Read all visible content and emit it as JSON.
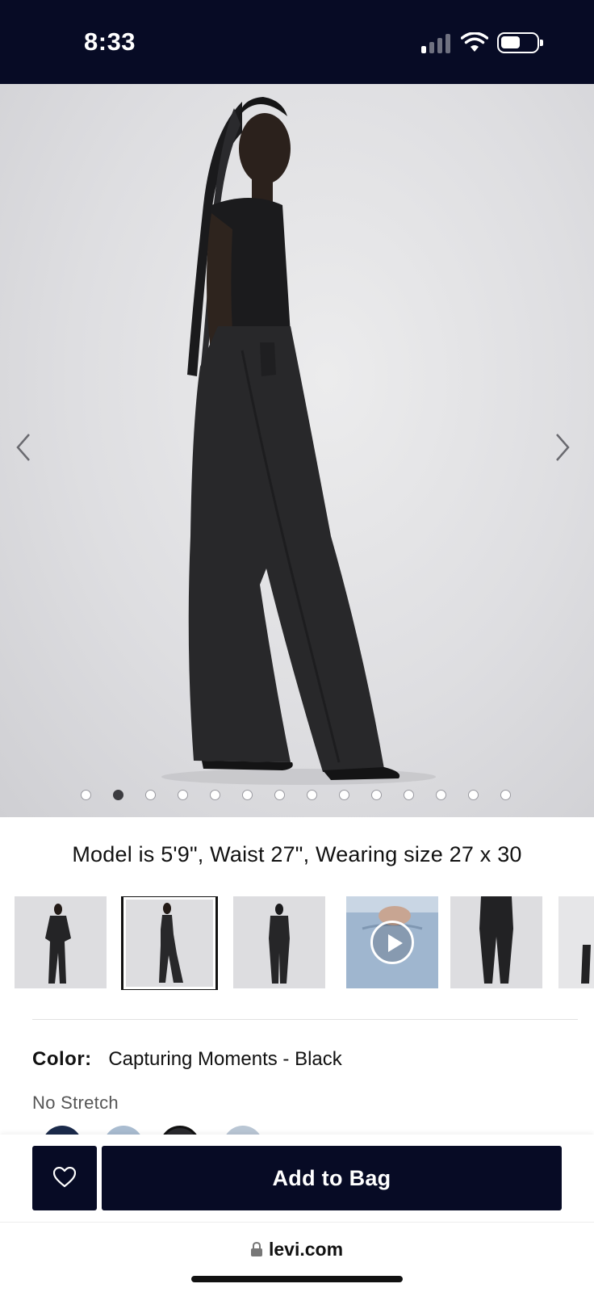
{
  "status_bar": {
    "time": "8:33",
    "icons": [
      "cellular-signal-icon",
      "wifi-icon",
      "battery-icon"
    ]
  },
  "gallery": {
    "image_count": 14,
    "active_index": 1,
    "icons": [
      "chevron-left-icon",
      "chevron-right-icon"
    ]
  },
  "model_caption": "Model is 5'9\", Waist 27\", Wearing size 27 x 30",
  "thumbnails": {
    "selected_index": 1,
    "video_index": 3,
    "icons": [
      "play-icon"
    ]
  },
  "product": {
    "color_label": "Color:",
    "color_value": "Capturing Moments - Black",
    "stretch": "No Stretch"
  },
  "swatch_colors": [
    "#1b2a4a",
    "#a9bcd0",
    "#2a2a2e",
    "#b9c6d4"
  ],
  "actions": {
    "favorite_icon": "heart-icon",
    "add_to_bag": "Add to Bag"
  },
  "browser": {
    "url": "levi.com",
    "lock_icon": "lock-icon"
  },
  "colors": {
    "brand_navy": "#070b25",
    "background": "#ffffff"
  }
}
